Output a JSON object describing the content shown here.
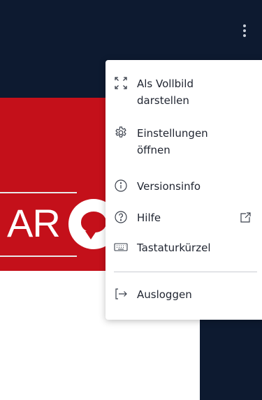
{
  "menu": {
    "fullscreen_l1": "Als Vollbild",
    "fullscreen_l2": "darstellen",
    "settings_l1": "Einstellungen",
    "settings_l2": "öffnen",
    "version": "Versionsinfo",
    "help": "Hilfe",
    "shortcuts": "Tastaturkürzel",
    "logout": "Ausloggen"
  },
  "banner": {
    "letters": "AR"
  },
  "icons": {
    "kebab": "more-vertical-icon",
    "fullscreen": "expand-arrows-icon",
    "settings": "gear-icon",
    "version": "info-circle-icon",
    "help": "question-circle-icon",
    "external": "external-link-icon",
    "shortcuts": "keyboard-icon",
    "logout": "logout-arrow-icon"
  },
  "colors": {
    "navy": "#0d1a30",
    "red": "#c4101a",
    "menu_text": "#1f2430"
  }
}
